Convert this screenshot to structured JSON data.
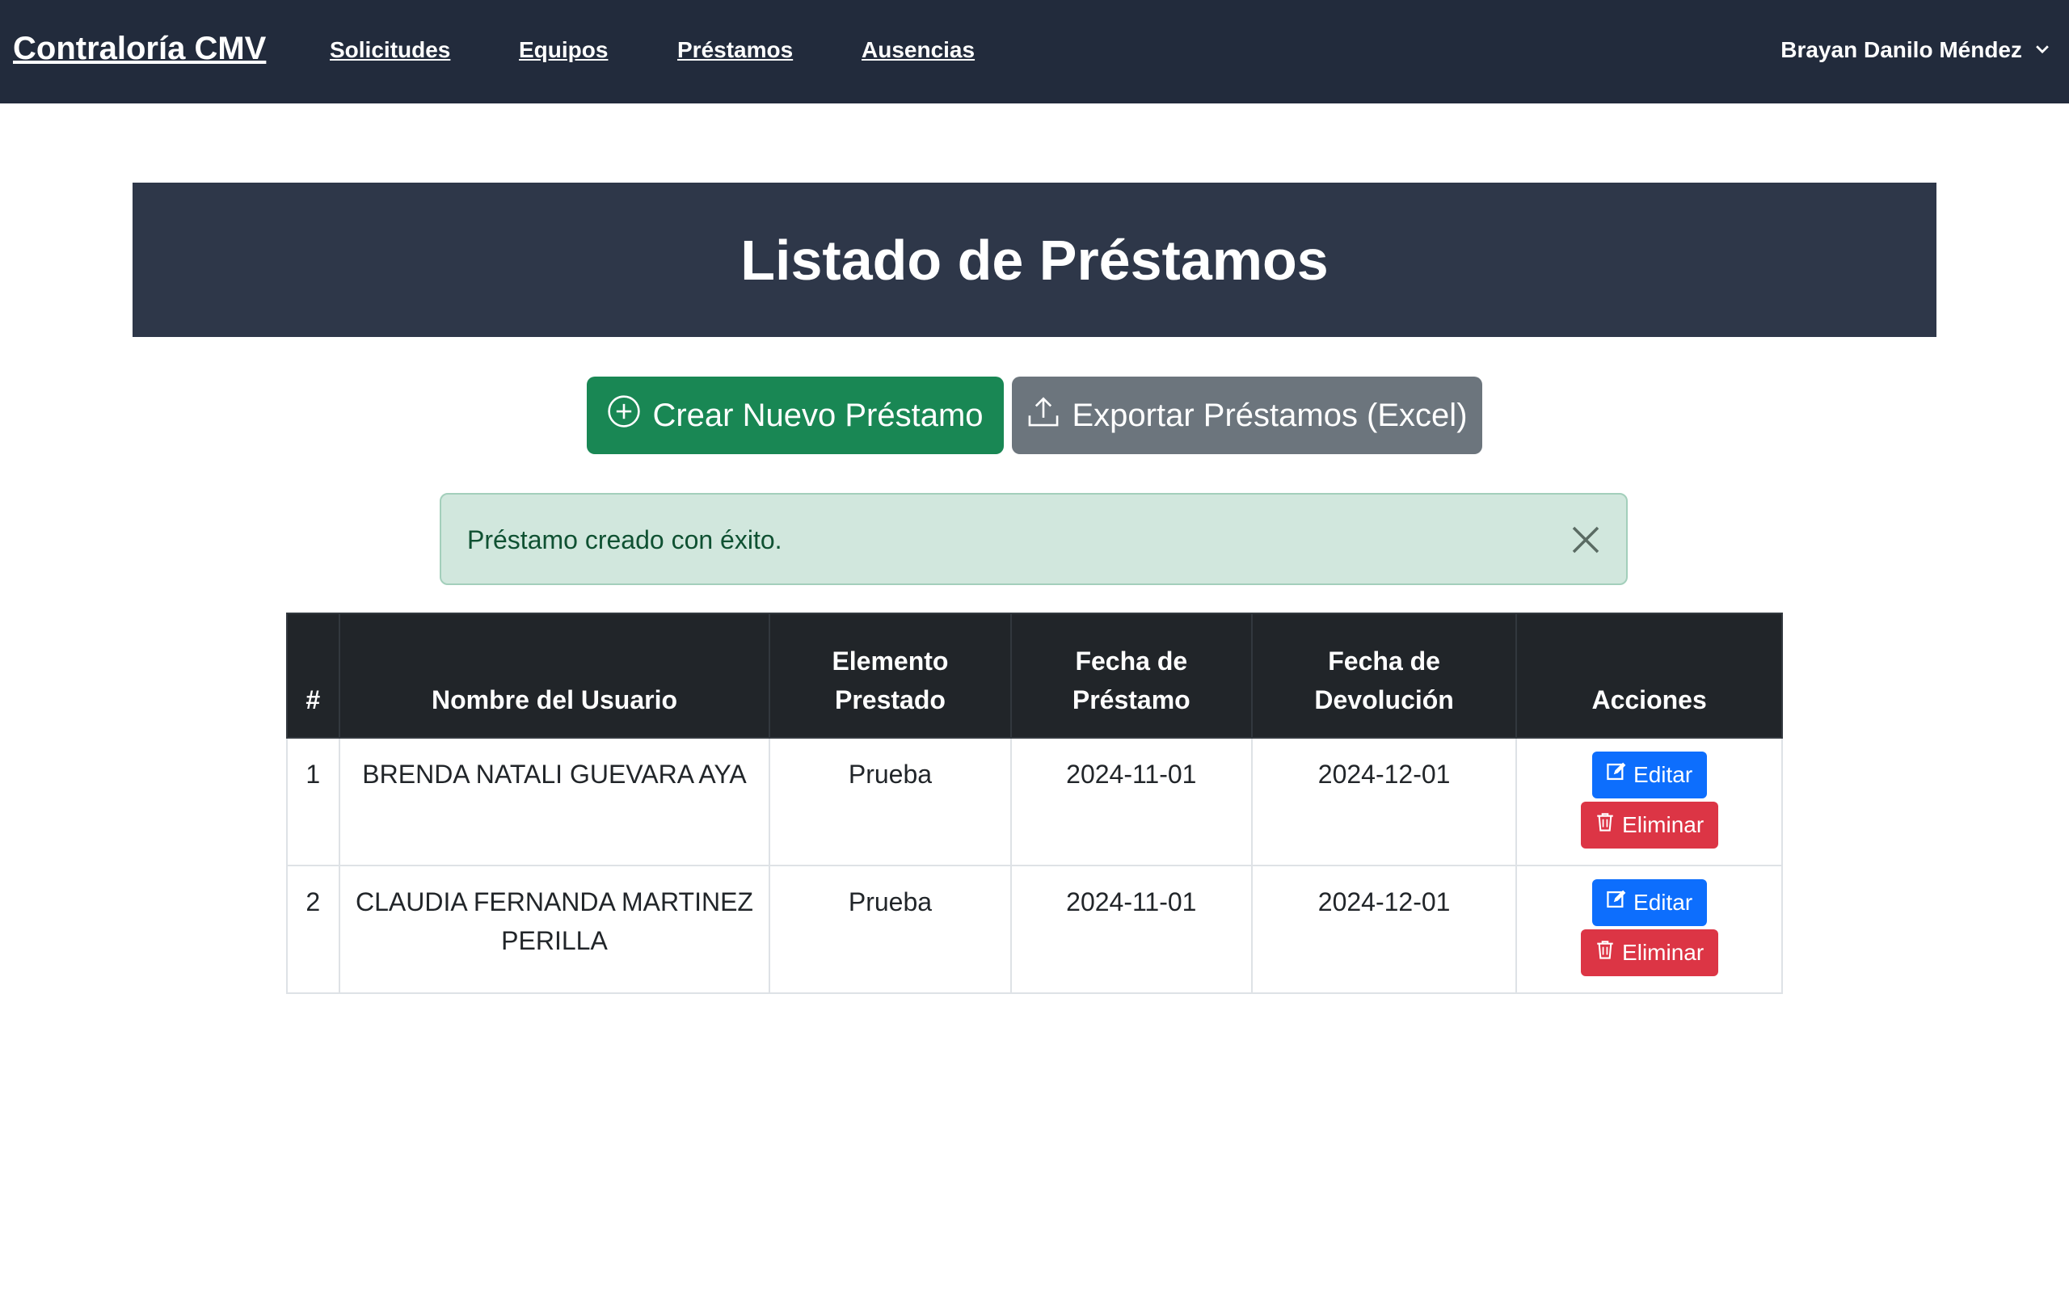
{
  "navbar": {
    "brand": "Contraloría CMV",
    "links": [
      "Solicitudes",
      "Equipos",
      "Préstamos",
      "Ausencias"
    ],
    "user": "Brayan Danilo Méndez"
  },
  "page": {
    "title": "Listado de Préstamos",
    "create_label": "Crear Nuevo Préstamo",
    "export_label": "Exportar Préstamos (Excel)"
  },
  "alert": {
    "message": "Préstamo creado con éxito."
  },
  "table": {
    "headers": [
      "#",
      "Nombre del Usuario",
      "Elemento Prestado",
      "Fecha de Préstamo",
      "Fecha de Devolución",
      "Acciones"
    ],
    "rows": [
      {
        "num": "1",
        "name": "BRENDA NATALI GUEVARA AYA",
        "item": "Prueba",
        "loan_date": "2024-11-01",
        "return_date": "2024-12-01"
      },
      {
        "num": "2",
        "name": "CLAUDIA FERNANDA MARTINEZ PERILLA",
        "item": "Prueba",
        "loan_date": "2024-11-01",
        "return_date": "2024-12-01"
      }
    ],
    "edit_label": "Editar",
    "delete_label": "Eliminar"
  },
  "colors": {
    "navbar": "#222b3c",
    "banner": "#2e3749",
    "success": "#198754",
    "secondary": "#6c757d",
    "primary": "#0d6efd",
    "danger": "#dc3545"
  }
}
